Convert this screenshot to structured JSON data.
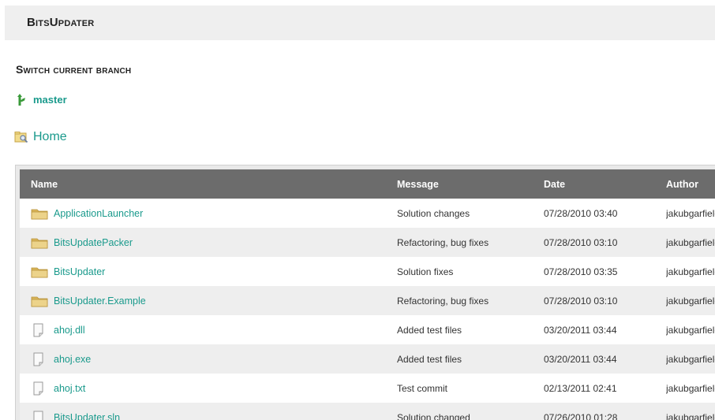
{
  "header": {
    "title": "BitsUpdater"
  },
  "branch_section": {
    "title": "Switch current branch",
    "current_branch": "master",
    "icon": "branch-icon"
  },
  "breadcrumb": {
    "home_label": "Home",
    "icon": "folder-search-icon"
  },
  "table": {
    "columns": [
      "Name",
      "Message",
      "Date",
      "Author"
    ],
    "rows": [
      {
        "type": "folder",
        "name": "ApplicationLauncher",
        "message": "Solution changes",
        "date": "07/28/2010 03:40",
        "author": "jakubgarfield"
      },
      {
        "type": "folder",
        "name": "BitsUpdatePacker",
        "message": "Refactoring, bug fixes",
        "date": "07/28/2010 03:10",
        "author": "jakubgarfield"
      },
      {
        "type": "folder",
        "name": "BitsUpdater",
        "message": "Solution fixes",
        "date": "07/28/2010 03:35",
        "author": "jakubgarfield"
      },
      {
        "type": "folder",
        "name": "BitsUpdater.Example",
        "message": "Refactoring, bug fixes",
        "date": "07/28/2010 03:10",
        "author": "jakubgarfield"
      },
      {
        "type": "file",
        "name": "ahoj.dll",
        "message": "Added test files",
        "date": "03/20/2011 03:44",
        "author": "jakubgarfield"
      },
      {
        "type": "file",
        "name": "ahoj.exe",
        "message": "Added test files",
        "date": "03/20/2011 03:44",
        "author": "jakubgarfield"
      },
      {
        "type": "file",
        "name": "ahoj.txt",
        "message": "Test commit",
        "date": "02/13/2011 02:41",
        "author": "jakubgarfield"
      },
      {
        "type": "file",
        "name": "BitsUpdater.sln",
        "message": "Solution changed",
        "date": "07/26/2010 01:28",
        "author": "jakubgarfield"
      }
    ]
  },
  "colors": {
    "accent": "#1a9a8c",
    "header_bg": "#6c6c6c",
    "folder": "#d9b45a"
  }
}
